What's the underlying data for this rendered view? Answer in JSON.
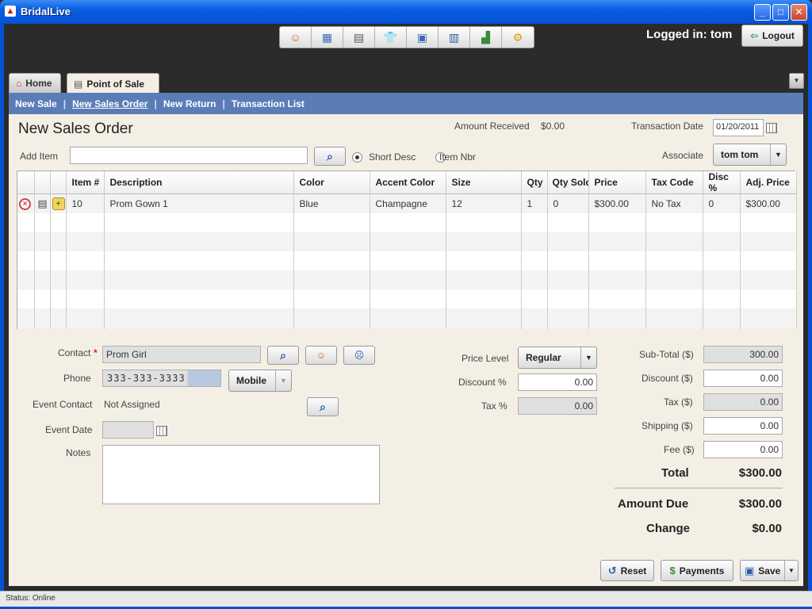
{
  "window": {
    "title": "BridalLive"
  },
  "header": {
    "logged_in": "Logged in: tom",
    "logout_label": "Logout"
  },
  "tabs": [
    {
      "label": "Home"
    },
    {
      "label": "Point of Sale"
    }
  ],
  "subnav": [
    {
      "label": "New Sale"
    },
    {
      "label": "New Sales Order"
    },
    {
      "label": "New Return"
    },
    {
      "label": "Transaction List"
    }
  ],
  "form": {
    "title": "New Sales Order",
    "amount_received_label": "Amount Received",
    "amount_received": "$0.00",
    "transaction_date_label": "Transaction Date",
    "transaction_date": "01/20/2011",
    "add_item_label": "Add Item",
    "short_desc_label": "Short Desc",
    "item_nbr_label": "Item Nbr",
    "associate_label": "Associate",
    "associate": "tom tom"
  },
  "grid": {
    "columns": [
      "Item #",
      "Description",
      "Color",
      "Accent Color",
      "Size",
      "Qty",
      "Qty Sold",
      "Price",
      "Tax Code",
      "Disc %",
      "Adj. Price"
    ],
    "rows": [
      [
        "10",
        "Prom Gown 1",
        "Blue",
        "Champagne",
        "12",
        "1",
        "0",
        "$300.00",
        "No Tax",
        "0",
        "$300.00"
      ]
    ]
  },
  "contact": {
    "contact_label": "Contact",
    "contact_value": "Prom Girl",
    "phone_label": "Phone",
    "phone_value": "333-333-3333",
    "phone_type": "Mobile",
    "event_contact_label": "Event Contact",
    "event_contact_value": "Not Assigned",
    "event_date_label": "Event Date",
    "notes_label": "Notes"
  },
  "pricing": {
    "price_level_label": "Price Level",
    "price_level": "Regular",
    "discount_label": "Discount %",
    "discount": "0.00",
    "tax_label": "Tax %",
    "tax": "0.00"
  },
  "totals": {
    "subtotal_label": "Sub-Total ($)",
    "subtotal": "300.00",
    "discount_label": "Discount ($)",
    "discount": "0.00",
    "tax_label": "Tax ($)",
    "tax": "0.00",
    "shipping_label": "Shipping ($)",
    "shipping": "0.00",
    "fee_label": "Fee ($)",
    "fee": "0.00",
    "total_label": "Total",
    "total": "$300.00",
    "amount_due_label": "Amount Due",
    "amount_due": "$300.00",
    "change_label": "Change",
    "change": "$0.00"
  },
  "actions": {
    "reset": "Reset",
    "payments": "Payments",
    "save": "Save"
  },
  "status": {
    "text": "Status: Online"
  },
  "colors": {
    "titlebar": "#0552d4",
    "subnav": "#5a7db8",
    "content": "#f4efe5"
  }
}
